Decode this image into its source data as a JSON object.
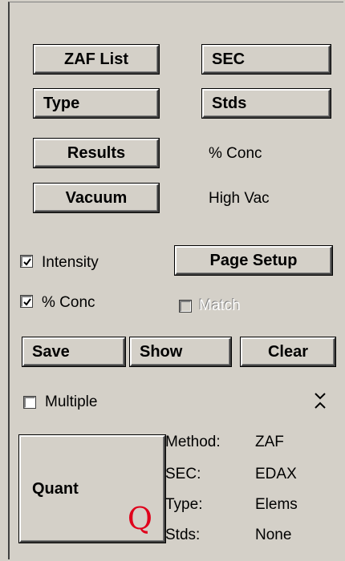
{
  "buttons": {
    "zaf_list": "ZAF List",
    "sec": "SEC",
    "type": "Type",
    "stds": "Stds",
    "results": "Results",
    "vacuum": "Vacuum",
    "page_setup": "Page Setup",
    "save": "Save",
    "show": "Show",
    "clear": "Clear",
    "quant": "Quant",
    "quant_glyph": "Q"
  },
  "status": {
    "results_value": "% Conc",
    "vacuum_value": "High Vac"
  },
  "checkboxes": {
    "intensity": {
      "label": "Intensity",
      "checked": true
    },
    "conc": {
      "label": "% Conc",
      "checked": true
    },
    "match": {
      "label": "Match",
      "checked": false,
      "disabled": true
    },
    "multiple": {
      "label": "Multiple",
      "checked": false
    }
  },
  "icons": {
    "collapse": "chevron-collapse-icon"
  },
  "info": {
    "method_label": "Method:",
    "method_value": "ZAF",
    "sec_label": "SEC:",
    "sec_value": "EDAX",
    "type_label": "Type:",
    "type_value": "Elems",
    "stds_label": "Stds:",
    "stds_value": "None"
  },
  "colors": {
    "background": "#d4d0c8",
    "quant_q": "#e0001b"
  }
}
